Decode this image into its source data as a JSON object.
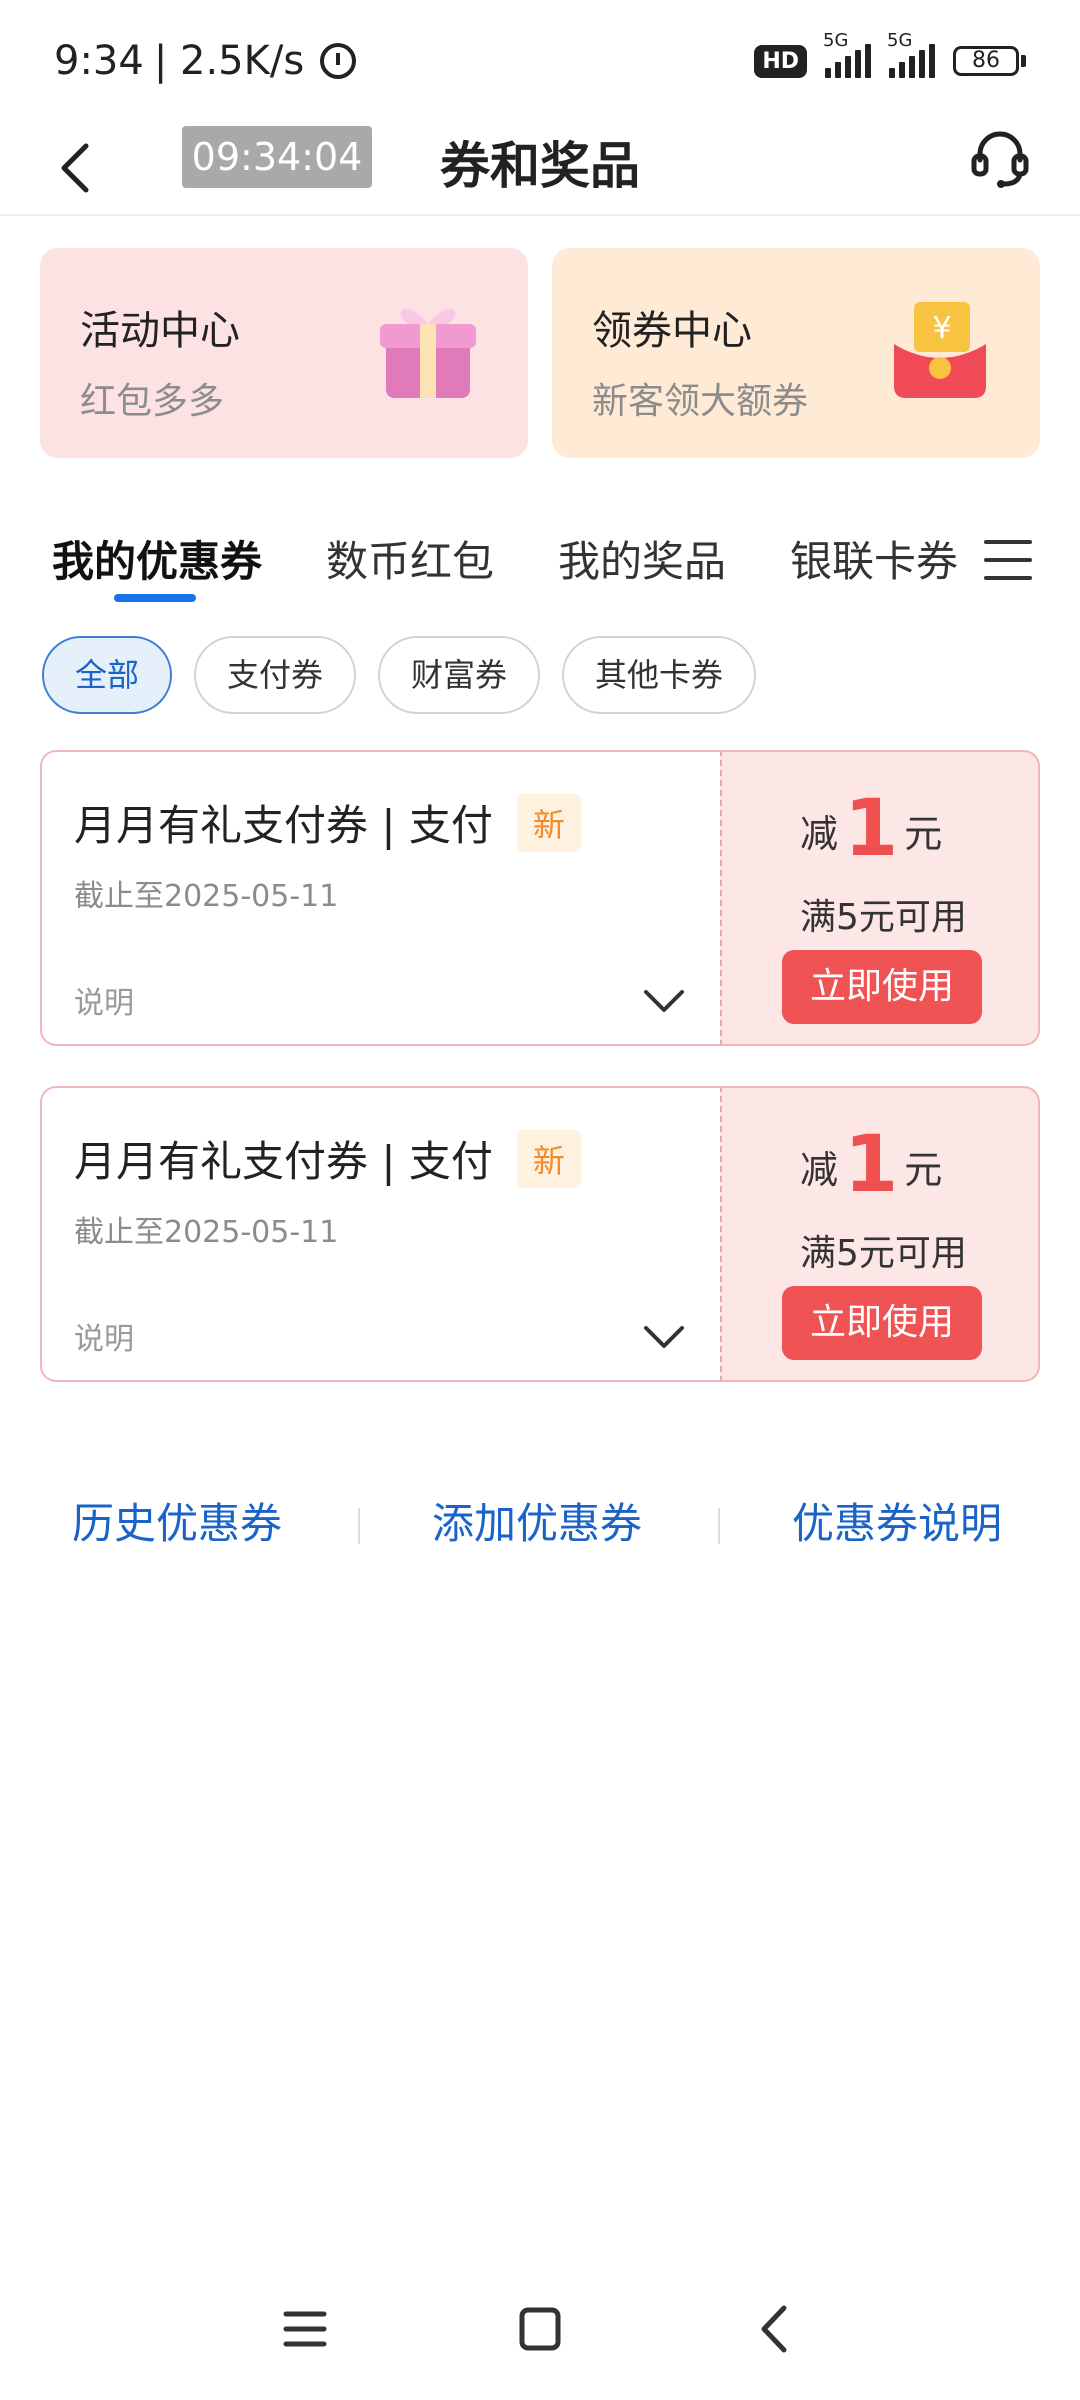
{
  "status_bar": {
    "time": "9:34",
    "speed": "| 2.5K/s",
    "hd_badge": "HD",
    "network_1": "5G",
    "network_2": "5G",
    "battery": "86"
  },
  "header": {
    "time_chip": "09:34:04",
    "title": "券和奖品"
  },
  "cards": {
    "activity": {
      "title": "活动中心",
      "subtitle": "红包多多"
    },
    "coupon": {
      "title": "领券中心",
      "subtitle": "新客领大额券"
    }
  },
  "tabs": [
    {
      "label": "我的优惠券"
    },
    {
      "label": "数币红包"
    },
    {
      "label": "我的奖品"
    },
    {
      "label": "银联卡券"
    }
  ],
  "filters": [
    {
      "label": "全部"
    },
    {
      "label": "支付券"
    },
    {
      "label": "财富券"
    },
    {
      "label": "其他卡券"
    }
  ],
  "coupons": [
    {
      "title": "月月有礼支付券 | 支付",
      "badge": "新",
      "expiry": "截止至2025-05-11",
      "desc_label": "说明",
      "discount_label": "减",
      "discount_value": "1",
      "discount_unit": "元",
      "threshold": "满5元可用",
      "button": "立即使用"
    },
    {
      "title": "月月有礼支付券 | 支付",
      "badge": "新",
      "expiry": "截止至2025-05-11",
      "desc_label": "说明",
      "discount_label": "减",
      "discount_value": "1",
      "discount_unit": "元",
      "threshold": "满5元可用",
      "button": "立即使用"
    }
  ],
  "bottom_links": {
    "history": "历史优惠券",
    "add": "添加优惠券",
    "explain": "优惠券说明"
  },
  "colors": {
    "accent_blue": "#1a63c8",
    "coupon_red": "#f05353",
    "activity_bg": "#fde2e4",
    "coupon_center_bg": "#ffead6"
  }
}
